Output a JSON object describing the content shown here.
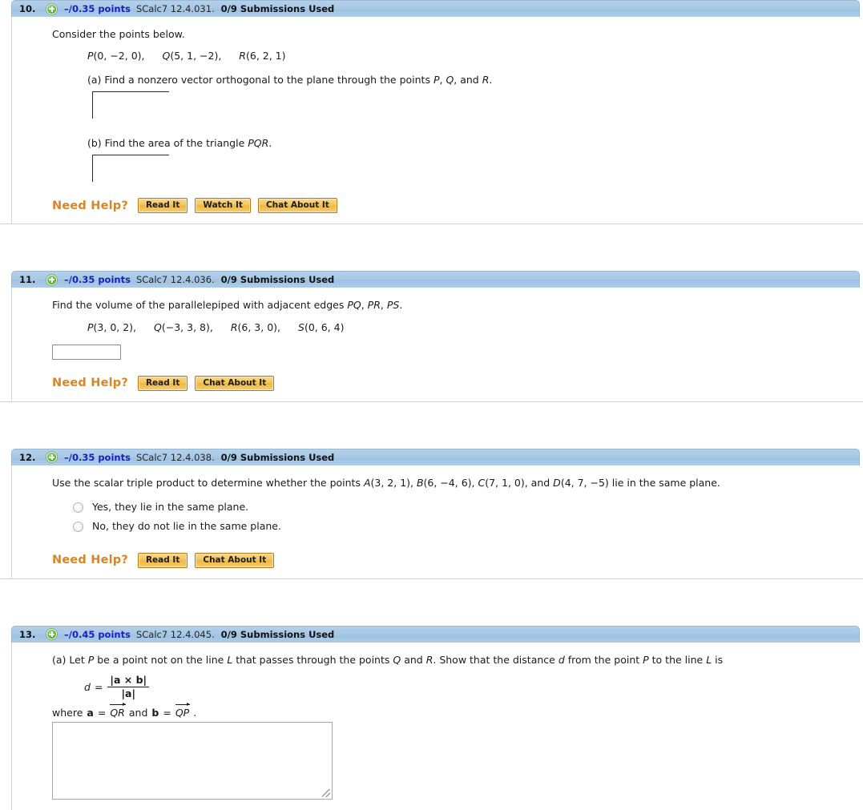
{
  "colors": {
    "header_blue": "#a9c9e6",
    "points_blue": "#1c20c4",
    "need_help_orange": "#d98427",
    "button_gold": "#f6c85f",
    "button_border": "#b9741a"
  },
  "labels": {
    "need_help": "Need Help?",
    "read_it": "Read It",
    "watch_it": "Watch It",
    "chat_about_it": "Chat About It"
  },
  "questions": [
    {
      "number": "10.",
      "points": "–/0.35 points",
      "source": "SCalc7 12.4.031.",
      "submissions": "0/9 Submissions Used",
      "stem": "Consider the points below.",
      "coords": [
        "P(0, −2, 0),",
        "Q(5, 1, −2),",
        "R(6, 2, 1)"
      ],
      "part_a": "(a) Find a nonzero vector orthogonal to the plane through the points P, Q, and R.",
      "part_b": "(b) Find the area of the triangle PQR.",
      "buttons": [
        "Read It",
        "Watch It",
        "Chat About It"
      ]
    },
    {
      "number": "11.",
      "points": "–/0.35 points",
      "source": "SCalc7 12.4.036.",
      "submissions": "0/9 Submissions Used",
      "stem": "Find the volume of the parallelepiped with adjacent edges PQ, PR, PS.",
      "coords": [
        "P(3, 0, 2),",
        "Q(−3, 3, 8),",
        "R(6, 3, 0),",
        "S(0, 6, 4)"
      ],
      "input_value": "",
      "buttons": [
        "Read It",
        "Chat About It"
      ]
    },
    {
      "number": "12.",
      "points": "–/0.35 points",
      "source": "SCalc7 12.4.038.",
      "submissions": "0/9 Submissions Used",
      "stem": "Use the scalar triple product to determine whether the points  A(3, 2, 1), B(6, −4, 6), C(7, 1, 0), and D(4, 7, −5)  lie in the same plane.",
      "choices": [
        "Yes, they lie in the same plane.",
        "No, they do not lie in the same plane."
      ],
      "buttons": [
        "Read It",
        "Chat About It"
      ]
    },
    {
      "number": "13.",
      "points": "–/0.45 points",
      "source": "SCalc7 12.4.045.",
      "submissions": "0/9 Submissions Used",
      "part_a": "(a) Let P be a point not on the line L that passes through the points Q and R. Show that the distance d from the point P to the line L is",
      "formula": {
        "lhs": "d",
        "eq": "=",
        "numerator": "|a × b|",
        "denominator": "|a|"
      },
      "where": {
        "prefix": "where",
        "a_label": "a",
        "a_eq": "=",
        "a_vec": "QR",
        "conj": "and",
        "b_label": "b",
        "b_eq": "=",
        "b_vec": "QP",
        "period": "."
      },
      "textarea_value": ""
    }
  ]
}
